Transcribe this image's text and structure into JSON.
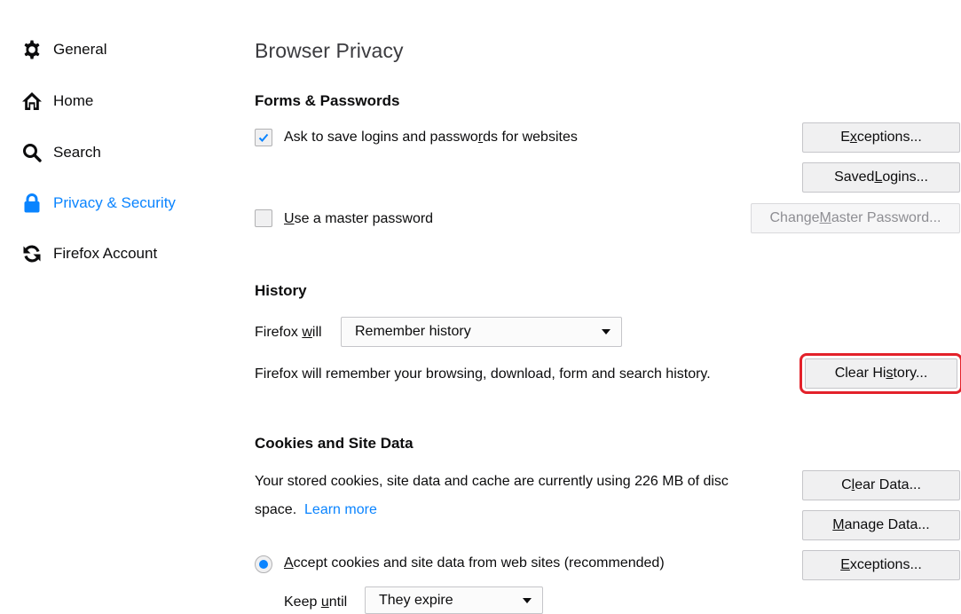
{
  "sidebar": {
    "items": [
      {
        "label": "General",
        "icon": "gear-icon"
      },
      {
        "label": "Home",
        "icon": "home-icon"
      },
      {
        "label": "Search",
        "icon": "search-icon"
      },
      {
        "label": "Privacy & Security",
        "icon": "lock-icon",
        "active": true
      },
      {
        "label": "Firefox Account",
        "icon": "sync-icon"
      }
    ]
  },
  "page": {
    "title": "Browser Privacy"
  },
  "forms": {
    "title": "Forms & Passwords",
    "ask_save": {
      "pre": "Ask to save logins and passwo",
      "key": "r",
      "post": "ds for websites",
      "checked": true
    },
    "exceptions_button": {
      "pre": "E",
      "key": "x",
      "post": "ceptions..."
    },
    "saved_logins_button": {
      "pre": "Saved ",
      "key": "L",
      "post": "ogins..."
    },
    "master_password": {
      "pre": "",
      "key": "U",
      "post": "se a master password",
      "checked": false
    },
    "change_master_button": {
      "pre": "Change ",
      "key": "M",
      "post": "aster Password...",
      "disabled": true
    }
  },
  "history": {
    "title": "History",
    "firefox_will": {
      "pre": "Firefox ",
      "key": "w",
      "post": "ill"
    },
    "mode_value": "Remember history",
    "description": "Firefox will remember your browsing, download, form and search history.",
    "clear_history_button": {
      "pre": "Clear Hi",
      "key": "s",
      "post": "tory..."
    }
  },
  "cookies": {
    "title": "Cookies and Site Data",
    "usage_line1": "Your stored cookies, site data and cache are currently using 226 MB of disc",
    "usage_line2": "space.",
    "learn_more": "Learn more",
    "clear_data_button": {
      "pre": "C",
      "key": "l",
      "post": "ear Data..."
    },
    "manage_data_button": {
      "pre": "",
      "key": "M",
      "post": "anage Data..."
    },
    "exceptions_button": {
      "pre": "",
      "key": "E",
      "post": "xceptions..."
    },
    "accept_option": {
      "pre": "",
      "key": "A",
      "post": "ccept cookies and site data from web sites (recommended)",
      "selected": true
    },
    "keep_until": {
      "pre": "Keep ",
      "key": "u",
      "post": "ntil"
    },
    "keep_value": "They expire"
  },
  "colors": {
    "accent": "#0a84ff",
    "highlight_box": "#e3212a"
  }
}
